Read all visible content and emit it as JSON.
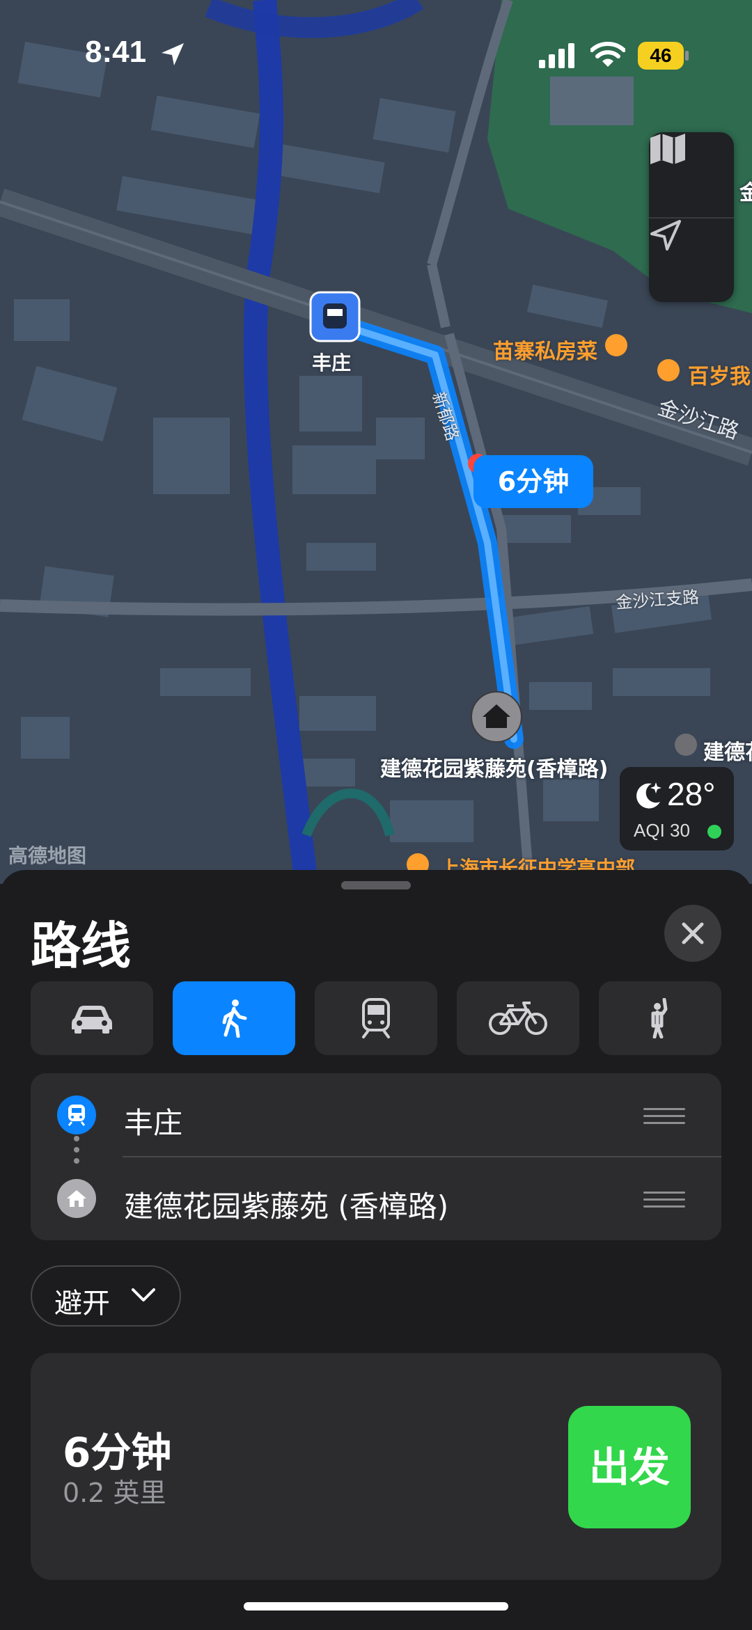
{
  "status_bar": {
    "time": "8:41",
    "battery": "46"
  },
  "map": {
    "station_label": "丰庄",
    "restaurant_label": "苗寨私房菜",
    "restaurant2_label": "百岁我",
    "road_jinshajiang": "金沙江路",
    "road_xinyu": "新郁路",
    "road_jinshajiang_branch": "金沙江支路",
    "destination_label": "建德花园紫藤苑(香樟路)",
    "destination2_label": "建德花",
    "school_label": "上海市长征中学高中部",
    "corner_label": "金",
    "watermark": "高德地图",
    "eta_bubble": "6分钟",
    "weather": {
      "temp": "28°",
      "aqi": "AQI 30"
    }
  },
  "sheet": {
    "title": "路线",
    "modes": [
      "car-icon",
      "walk-icon",
      "transit-icon",
      "bike-icon",
      "rideshare-icon"
    ],
    "active_mode": "walk",
    "stops": [
      {
        "name": "丰庄",
        "icon": "train-icon"
      },
      {
        "name": "建德花园紫藤苑 (香樟路)",
        "icon": "home-icon"
      }
    ],
    "avoid_label": "避开",
    "route": {
      "duration": "6分钟",
      "distance": "0.2 英里",
      "go_label": "出发"
    }
  },
  "colors": {
    "accent": "#0a84ff",
    "go": "#32d74b",
    "map_bg": "#3a4656"
  }
}
